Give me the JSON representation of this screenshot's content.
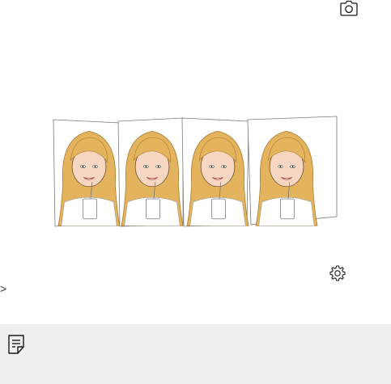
{
  "icons": {
    "camera": "camera-icon",
    "settings": "gear-icon",
    "chevron": "chevron-right-icon",
    "note": "note-icon"
  },
  "chevron_text": ">",
  "colors": {
    "note_background": "#efefef",
    "icon_stroke": "#1a1a1a",
    "hair": "#d9a64a",
    "skin": "#f6d2bb"
  }
}
